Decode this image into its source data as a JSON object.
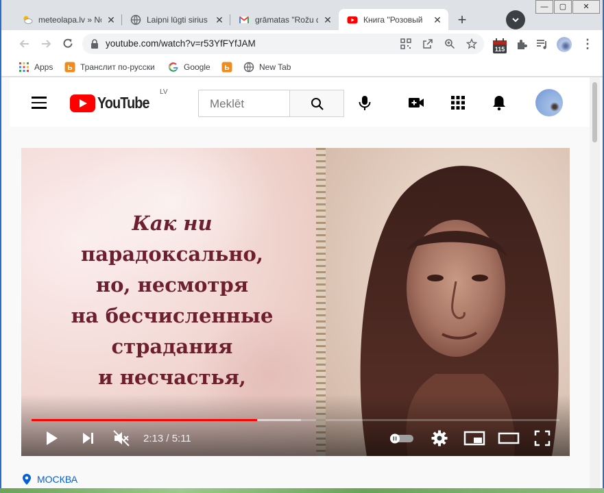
{
  "tabs": [
    {
      "title": "meteolapa.lv » No",
      "close": "✕",
      "icon": "cloud-sun-icon"
    },
    {
      "title": "Laipni lūgti sirius",
      "close": "✕",
      "icon": "globe-icon"
    },
    {
      "title": "grāmatas \"Rožu d",
      "close": "✕",
      "icon": "gmail-icon"
    },
    {
      "title": "Книга \"Розовый",
      "close": "✕",
      "icon": "youtube-icon"
    }
  ],
  "window_controls": {
    "minimize": "—",
    "maximize": "▢",
    "close": "✕"
  },
  "new_tab": "+",
  "toolbar": {
    "url": "youtube.com/watch?v=r53YfFYfJAM",
    "calendar_badge": "115"
  },
  "bookmarks": [
    {
      "label": "Apps",
      "icon": "apps-grid-icon"
    },
    {
      "label": "Транслит по-русски",
      "icon": "translit-icon"
    },
    {
      "label": "Google",
      "icon": "google-icon"
    },
    {
      "label": "",
      "icon": "translit-icon"
    },
    {
      "label": "New Tab",
      "icon": "globe-icon"
    }
  ],
  "youtube": {
    "logo_text": "YouTube",
    "country_code": "LV",
    "search_placeholder": "Meklēt"
  },
  "video": {
    "quote_lines": [
      "Как ни",
      "парадоксально,",
      "но, несмотря",
      "на бесчисленные",
      "страдания",
      "и несчастья,"
    ],
    "current_time": "2:13",
    "duration": "5:11",
    "time_display": "2:13 / 5:11",
    "played_fraction": 0.4277,
    "buffered_fraction": 0.51,
    "muted": true,
    "autoplay": "off"
  },
  "location": "МОСКВА",
  "colors": {
    "youtube_red": "#ff0000",
    "quote_text": "#6e1f2e",
    "link_blue": "#065fd4"
  }
}
